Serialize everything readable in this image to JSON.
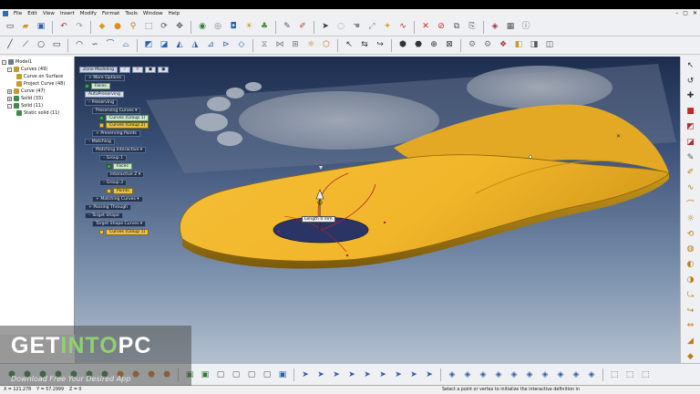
{
  "menubar": {
    "items": [
      "File",
      "Edit",
      "View",
      "Insert",
      "Modify",
      "Format",
      "Tools",
      "Window",
      "Help"
    ],
    "window_controls": [
      "–",
      "▢",
      "✕"
    ]
  },
  "toolbar_top": {
    "icons": [
      "new-file-icon",
      "open-file-icon",
      "save-icon",
      "undo-icon",
      "redo-icon",
      "shaded-cube-icon",
      "sphere-icon",
      "zoom-icon",
      "fit-icon",
      "rotate-icon",
      "pan-icon",
      "select-arrow-icon",
      "lasso-icon",
      "car-icon",
      "wire-car-icon",
      "camera-icon",
      "lamp-icon",
      "delete-icon",
      "tree-icon"
    ]
  },
  "toolbar_second": {
    "icons": [
      "line-icon",
      "polyline-icon",
      "circle-icon",
      "rectangle-icon",
      "arc-icon",
      "spline-icon",
      "curve-offset-icon",
      "curve-project-icon",
      "surface-icon",
      "loft-icon",
      "sweep-icon",
      "fillet-icon",
      "trim-icon",
      "extend-icon",
      "blend-icon",
      "mirror-icon",
      "pattern-icon",
      "measure-icon"
    ]
  },
  "tree": {
    "root": "Model1",
    "nodes": [
      {
        "label": "Curves (49)",
        "level": 1,
        "color": "#c59a2e"
      },
      {
        "label": "Curve on Surface",
        "level": 2,
        "color": "#c59a2e"
      },
      {
        "label": "Project Curve (48)",
        "level": 2,
        "color": "#c59a2e"
      },
      {
        "label": "Curve (47)",
        "level": 1,
        "color": "#c59a2e"
      },
      {
        "label": "Solid (33)",
        "level": 1,
        "color": "#3b8a4a"
      },
      {
        "label": "Solid (11)",
        "level": 1,
        "color": "#3b8a4a"
      },
      {
        "label": "Static solid (11)",
        "level": 2,
        "color": "#3b8a4a"
      }
    ]
  },
  "panel": {
    "header": "Zone Modeling",
    "more_options": "More Options",
    "faces": "Faces",
    "auto_preserving": "AutoPreserving",
    "preserving": "Preserving",
    "preserving_curves": "Preserving Curves",
    "curves_group1": "Curves (Group 1)",
    "curves_group2": "Curves (Group 2)",
    "preserving_points": "Preserving Points",
    "matching": "Matching",
    "matching_interactive": "Matching Interactive",
    "group1": "Group 1",
    "faces_item": "Faces",
    "interactive": "Interactive Z",
    "group2": "Group 2",
    "points": "Points",
    "matching_curves": "Matching Curves",
    "passing_through": "Passing Through",
    "target_shape": "Target Shape",
    "target_shape_curves": "Target Shape Curves",
    "curves_group1b": "Curves (Group 1)"
  },
  "measurement": {
    "label": "Length",
    "value": "0 mm"
  },
  "status": {
    "coord_x": "X = 121.278",
    "coord_y": "Y = 57.2999",
    "coord_z": "Z = 0",
    "message": "Select a point or vertex to initialize the interactive definition in"
  },
  "watermark": {
    "title_a": "GET ",
    "title_b": "INTO",
    "title_c": " PC",
    "subtitle": "Download Free Your Desired App"
  },
  "colors": {
    "insole": "#f2b62a",
    "insole_dark": "#b98716",
    "viewport_top": "#1d2d4e",
    "watermark_green": "#8fd16f"
  }
}
